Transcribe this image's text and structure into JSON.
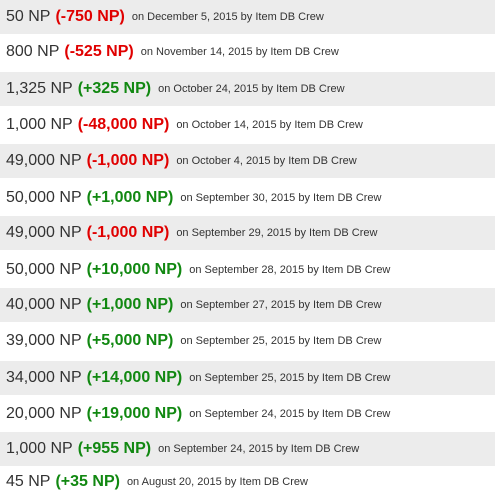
{
  "colors": {
    "decrease": "#e00000",
    "increase": "#118811",
    "row_shade": "#ececec",
    "text": "#333333"
  },
  "price_history": [
    {
      "price": "50 NP",
      "change": "(-750 NP)",
      "direction": "down",
      "meta": "on December 5, 2015  by Item DB Crew"
    },
    {
      "price": "800 NP",
      "change": "(-525 NP)",
      "direction": "down",
      "meta": "on November 14, 2015  by Item DB Crew"
    },
    {
      "price": "1,325 NP",
      "change": "(+325 NP)",
      "direction": "up",
      "meta": "on October 24, 2015  by Item DB Crew"
    },
    {
      "price": "1,000 NP",
      "change": "(-48,000 NP)",
      "direction": "down",
      "meta": "on October 14, 2015  by Item DB Crew"
    },
    {
      "price": "49,000 NP",
      "change": "(-1,000 NP)",
      "direction": "down",
      "meta": "on October 4, 2015  by Item DB Crew"
    },
    {
      "price": "50,000 NP",
      "change": "(+1,000 NP)",
      "direction": "up",
      "meta": "on September 30, 2015  by Item DB Crew"
    },
    {
      "price": "49,000 NP",
      "change": "(-1,000 NP)",
      "direction": "down",
      "meta": "on September 29, 2015  by Item DB Crew"
    },
    {
      "price": "50,000 NP",
      "change": "(+10,000 NP)",
      "direction": "up",
      "meta": "on September 28, 2015  by Item DB Crew"
    },
    {
      "price": "40,000 NP",
      "change": "(+1,000 NP)",
      "direction": "up",
      "meta": "on September 27, 2015  by Item DB Crew"
    },
    {
      "price": "39,000 NP",
      "change": "(+5,000 NP)",
      "direction": "up",
      "meta": "on September 25, 2015  by Item DB Crew"
    },
    {
      "price": "34,000 NP",
      "change": "(+14,000 NP)",
      "direction": "up",
      "meta": "on September 25, 2015  by Item DB Crew"
    },
    {
      "price": "20,000 NP",
      "change": "(+19,000 NP)",
      "direction": "up",
      "meta": "on September 24, 2015  by Item DB Crew"
    },
    {
      "price": "1,000 NP",
      "change": "(+955 NP)",
      "direction": "up",
      "meta": "on September 24, 2015  by Item DB Crew"
    },
    {
      "price": "45 NP",
      "change": "(+35 NP)",
      "direction": "up",
      "meta": "on August 20, 2015  by Item DB Crew"
    }
  ]
}
